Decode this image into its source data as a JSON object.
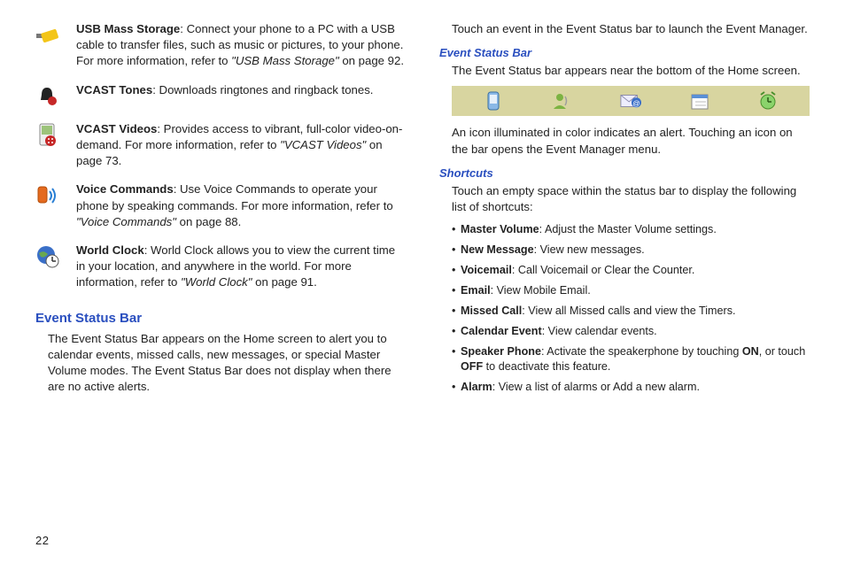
{
  "page_number": "22",
  "features": [
    {
      "title": "USB Mass Storage",
      "desc": ": Connect your phone to a PC with a USB cable to transfer files, such as music or pictures, to your phone. For more information, refer to ",
      "ref": "\"USB Mass Storage\"",
      "tail": " on page 92.",
      "icon": "usb-stick-icon"
    },
    {
      "title": "VCAST Tones",
      "desc": ": Downloads ringtones and ringback tones.",
      "ref": "",
      "tail": "",
      "icon": "bell-icon"
    },
    {
      "title": "VCAST Videos",
      "desc": ": Provides access to vibrant, full-color video-on-demand. For more information, refer to ",
      "ref": "\"VCAST Videos\"",
      "tail": " on page 73.",
      "icon": "video-player-icon"
    },
    {
      "title": "Voice Commands",
      "desc": ": Use Voice Commands to operate your phone by speaking commands. For more information, refer to ",
      "ref": "\"Voice Commands\"",
      "tail": " on page 88.",
      "icon": "voice-icon"
    },
    {
      "title": "World Clock",
      "desc": ": World Clock allows you to view the current time in your location, and anywhere in the world. For more information, refer to ",
      "ref": "\"World Clock\"",
      "tail": " on page 91.",
      "icon": "world-clock-icon"
    }
  ],
  "left_section": {
    "heading": "Event Status Bar",
    "para": "The Event Status Bar appears on the Home screen to alert you to calendar events, missed calls, new messages, or special Master Volume modes. The Event Status Bar does not display when there are no active alerts."
  },
  "right": {
    "para_top": "Touch an event in the Event Status bar to launch the Event Manager.",
    "sub1": "Event Status Bar",
    "sub1_para": "The Event Status bar appears near the bottom of the Home screen.",
    "sub1_after": "An icon illuminated in color indicates an alert. Touching an icon on the bar opens the Event Manager menu.",
    "sub2": "Shortcuts",
    "sub2_intro": "Touch an empty space within the status bar to display the following list of shortcuts:",
    "shortcuts": [
      {
        "term": "Master Volume",
        "rest": ": Adjust the Master Volume settings."
      },
      {
        "term": "New Message",
        "rest": ": View new messages."
      },
      {
        "term": "Voicemail",
        "rest": ": Call Voicemail or Clear the Counter."
      },
      {
        "term": "Email",
        "rest": ": View Mobile Email."
      },
      {
        "term": "Missed Call",
        "rest": ": View all Missed calls and view the Timers."
      },
      {
        "term": "Calendar Event",
        "rest": ": View calendar events."
      }
    ],
    "speaker_prefix": "Speaker Phone",
    "speaker_mid1": ": Activate the speakerphone by touching ",
    "speaker_on": "ON",
    "speaker_mid2": ", or touch ",
    "speaker_off": "OFF",
    "speaker_end": " to deactivate this feature.",
    "alarm_term": "Alarm",
    "alarm_rest": ": View a list of alarms or Add a new alarm."
  },
  "status_icons": [
    "phone-icon",
    "person-icon",
    "email-at-icon",
    "calendar-icon",
    "alarm-clock-icon"
  ]
}
